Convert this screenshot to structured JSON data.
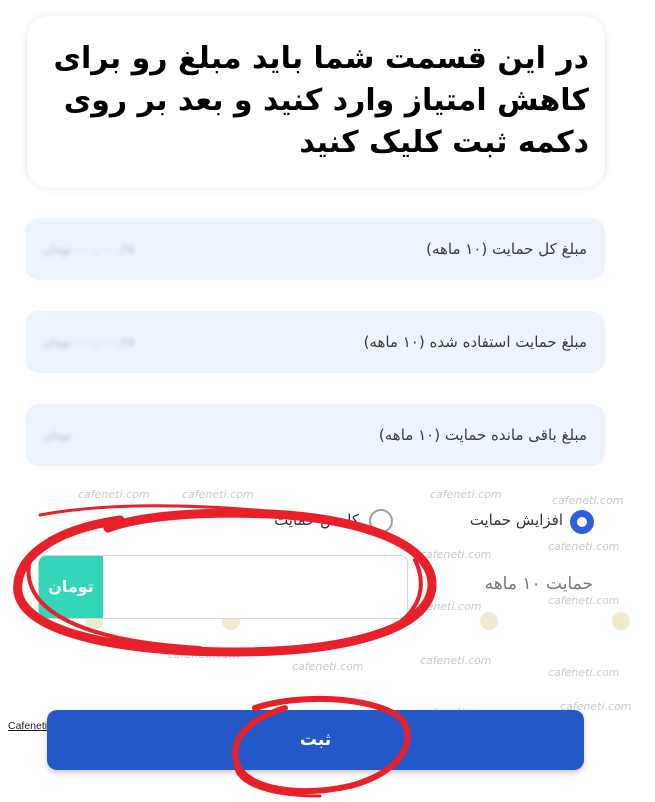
{
  "callout": {
    "text": "در این قسمت شما باید مبلغ رو برای کاهش امتیاز وارد کنید و بعد بر روی دکمه ثبت کلیک کنید"
  },
  "info_rows": [
    {
      "label": "مبلغ کل حمایت (۱۰ ماهه)",
      "value": "۰۰۰,۰۰۰,۲۵ تومان"
    },
    {
      "label": "مبلغ حمایت استفاده شده (۱۰ ماهه)",
      "value": "۰۰۰,۰۰۰,۲۵ تومان"
    },
    {
      "label": "مبلغ باقی مانده حمایت (۱۰ ماهه)",
      "value": "۰ تومان"
    }
  ],
  "options": {
    "increase": "افزایش حمایت",
    "decrease": "کاهش حمایت",
    "selected": "increase"
  },
  "amount": {
    "label": "حمایت ۱۰ ماهه",
    "value": "",
    "unit": "تومان"
  },
  "submit_label": "ثبت",
  "watermark": "cafeneti.com",
  "copyright": "Cafeneti.com, All Rights Reserved 2026 ©",
  "colors": {
    "primary": "#2358c9",
    "radio": "#2f5fe0",
    "unit_badge": "#33d6b8",
    "annotation": "#e8202a",
    "row_bg": "#eef4fd"
  }
}
